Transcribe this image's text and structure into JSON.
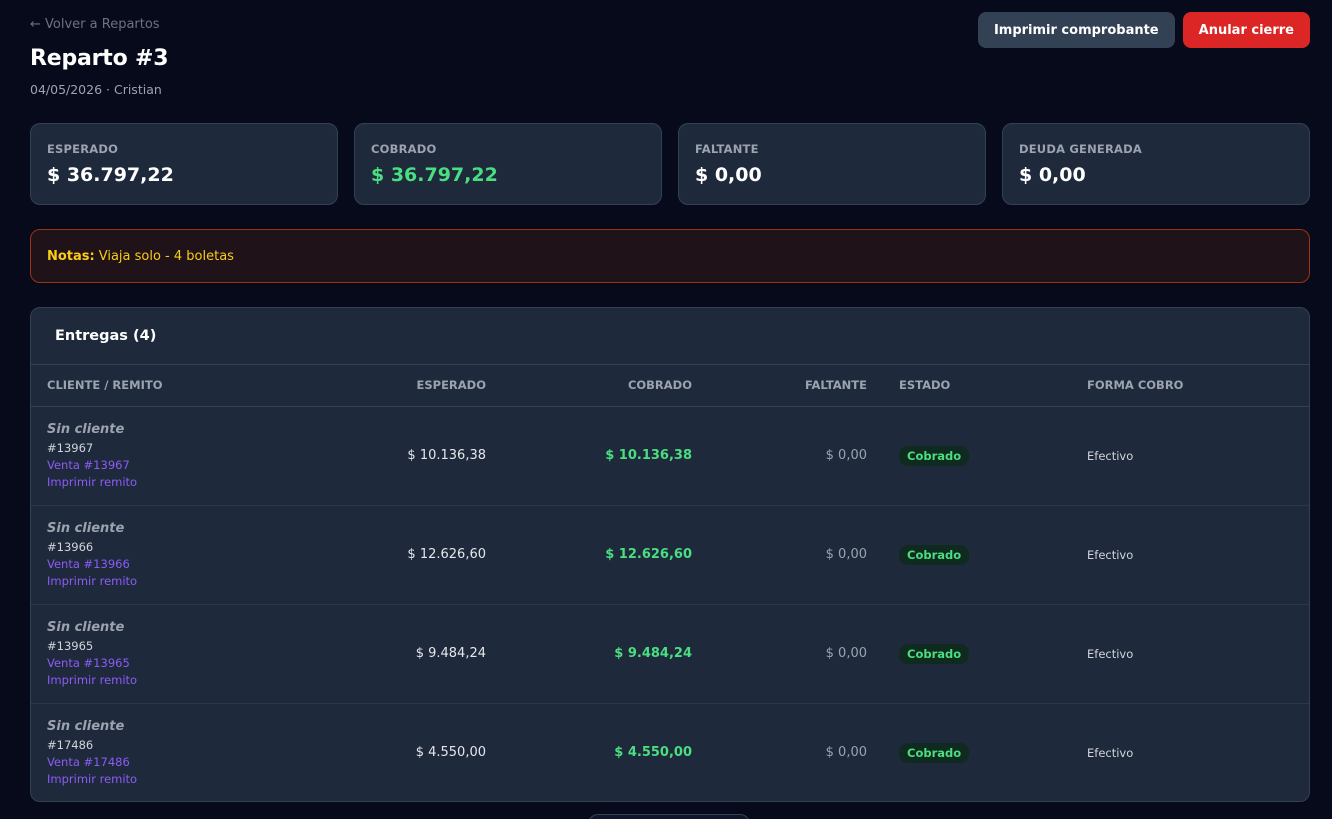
{
  "header": {
    "back_label": "← Volver a Repartos",
    "title": "Reparto #3",
    "subtitle": "04/05/2026 · Cristian",
    "print_label": "Imprimir comprobante",
    "annul_label": "Anular cierre"
  },
  "stats": {
    "expected_label": "ESPERADO",
    "expected_value": "$ 36.797,22",
    "collected_label": "COBRADO",
    "collected_value": "$ 36.797,22",
    "missing_label": "FALTANTE",
    "missing_value": "$ 0,00",
    "debt_label": "DEUDA GENERADA",
    "debt_value": "$ 0,00"
  },
  "notes": {
    "label": "Notas:",
    "text": "Viaja solo - 4 boletas"
  },
  "deliveries": {
    "title": "Entregas (4)",
    "columns": [
      "CLIENTE / REMITO",
      "ESPERADO",
      "COBRADO",
      "FALTANTE",
      "ESTADO",
      "FORMA COBRO"
    ],
    "rows": [
      {
        "client": "Sin cliente",
        "remito": "#13967",
        "sale_link": "Venta #13967",
        "print_link": "Imprimir remito",
        "expected": "$ 10.136,38",
        "collected": "$ 10.136,38",
        "missing": "$ 0,00",
        "status": "Cobrado",
        "method": "Efectivo"
      },
      {
        "client": "Sin cliente",
        "remito": "#13966",
        "sale_link": "Venta #13966",
        "print_link": "Imprimir remito",
        "expected": "$ 12.626,60",
        "collected": "$ 12.626,60",
        "missing": "$ 0,00",
        "status": "Cobrado",
        "method": "Efectivo"
      },
      {
        "client": "Sin cliente",
        "remito": "#13965",
        "sale_link": "Venta #13965",
        "print_link": "Imprimir remito",
        "expected": "$ 9.484,24",
        "collected": "$ 9.484,24",
        "missing": "$ 0,00",
        "status": "Cobrado",
        "method": "Efectivo"
      },
      {
        "client": "Sin cliente",
        "remito": "#17486",
        "sale_link": "Venta #17486",
        "print_link": "Imprimir remito",
        "expected": "$ 4.550,00",
        "collected": "$ 4.550,00",
        "missing": "$ 0,00",
        "status": "Cobrado",
        "method": "Efectivo"
      }
    ]
  },
  "colors": {
    "background": "#070a1a",
    "card": "#1e293b",
    "success": "#4ade80",
    "danger": "#dc2626",
    "link": "#8b5cf6",
    "note_text": "#facc15"
  }
}
